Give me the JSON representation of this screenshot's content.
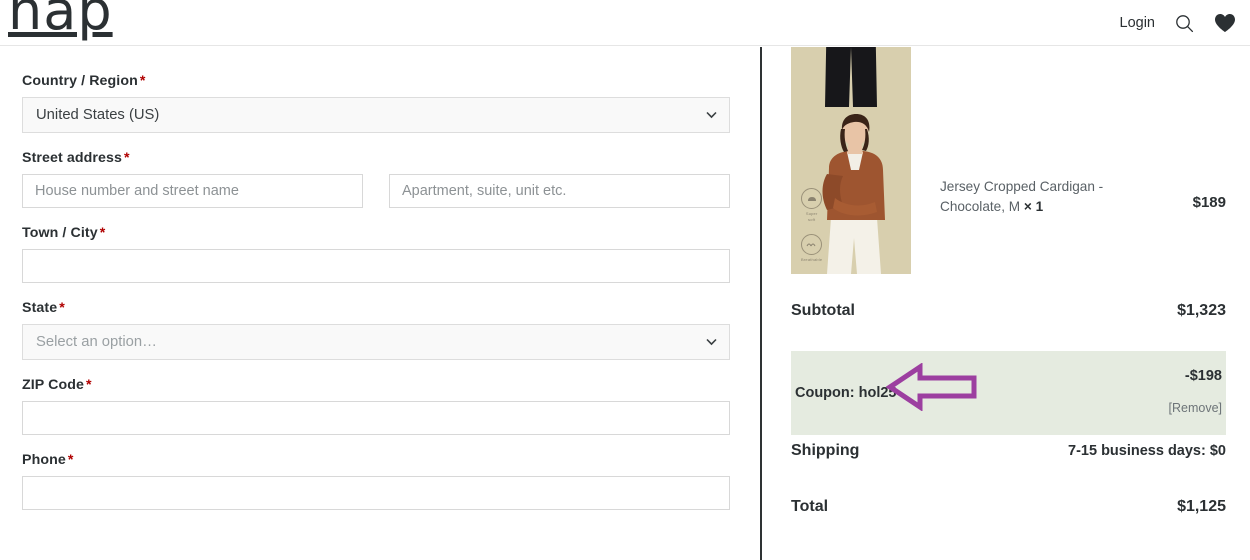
{
  "header": {
    "brand": "nap",
    "login_label": "Login",
    "search_icon": "search-icon",
    "wishlist_icon": "heart-icon"
  },
  "checkout_form": {
    "required_marker": "*",
    "fields": [
      {
        "name": "country",
        "label": "Country / Region",
        "required": true,
        "type": "select",
        "value": "United States (US)"
      },
      {
        "name": "street_address",
        "label": "Street address",
        "required": true,
        "type": "text-pair",
        "value": "",
        "placeholder": "House number and street name",
        "value2": "",
        "placeholder2": "Apartment, suite, unit etc."
      },
      {
        "name": "city",
        "label": "Town / City",
        "required": true,
        "type": "text",
        "value": "",
        "placeholder": ""
      },
      {
        "name": "state",
        "label": "State",
        "required": true,
        "type": "select",
        "value": "Select an option…"
      },
      {
        "name": "zip",
        "label": "ZIP Code",
        "required": true,
        "type": "text",
        "value": "",
        "placeholder": ""
      },
      {
        "name": "phone",
        "label": "Phone",
        "required": true,
        "type": "text",
        "value": "",
        "placeholder": ""
      }
    ]
  },
  "order_summary": {
    "items": [
      {
        "name": "",
        "quantity": "",
        "price": "",
        "clipped": true
      },
      {
        "name": "Jersey Cropped Cardigan - Chocolate, M",
        "quantity": "× 1",
        "price": "$189",
        "clipped": false
      }
    ],
    "subtotal_label": "Subtotal",
    "subtotal_value": "$1,323",
    "coupon_label": "Coupon: hol25",
    "coupon_amount": "-$198",
    "coupon_remove_label": "[Remove]",
    "shipping_label": "Shipping",
    "shipping_value": "7-15 business days: $0",
    "total_label": "Total",
    "total_value": "$1,125"
  },
  "annotation": {
    "arrow_color": "#9c3fa0",
    "arrow_direction": "left",
    "points_at": "Coupon: hol25"
  },
  "colors": {
    "coupon_band": "#e5ebe0",
    "divider": "#2e3234",
    "required_asterisk": "#b00000",
    "thumb_background": "#d8cfae"
  }
}
